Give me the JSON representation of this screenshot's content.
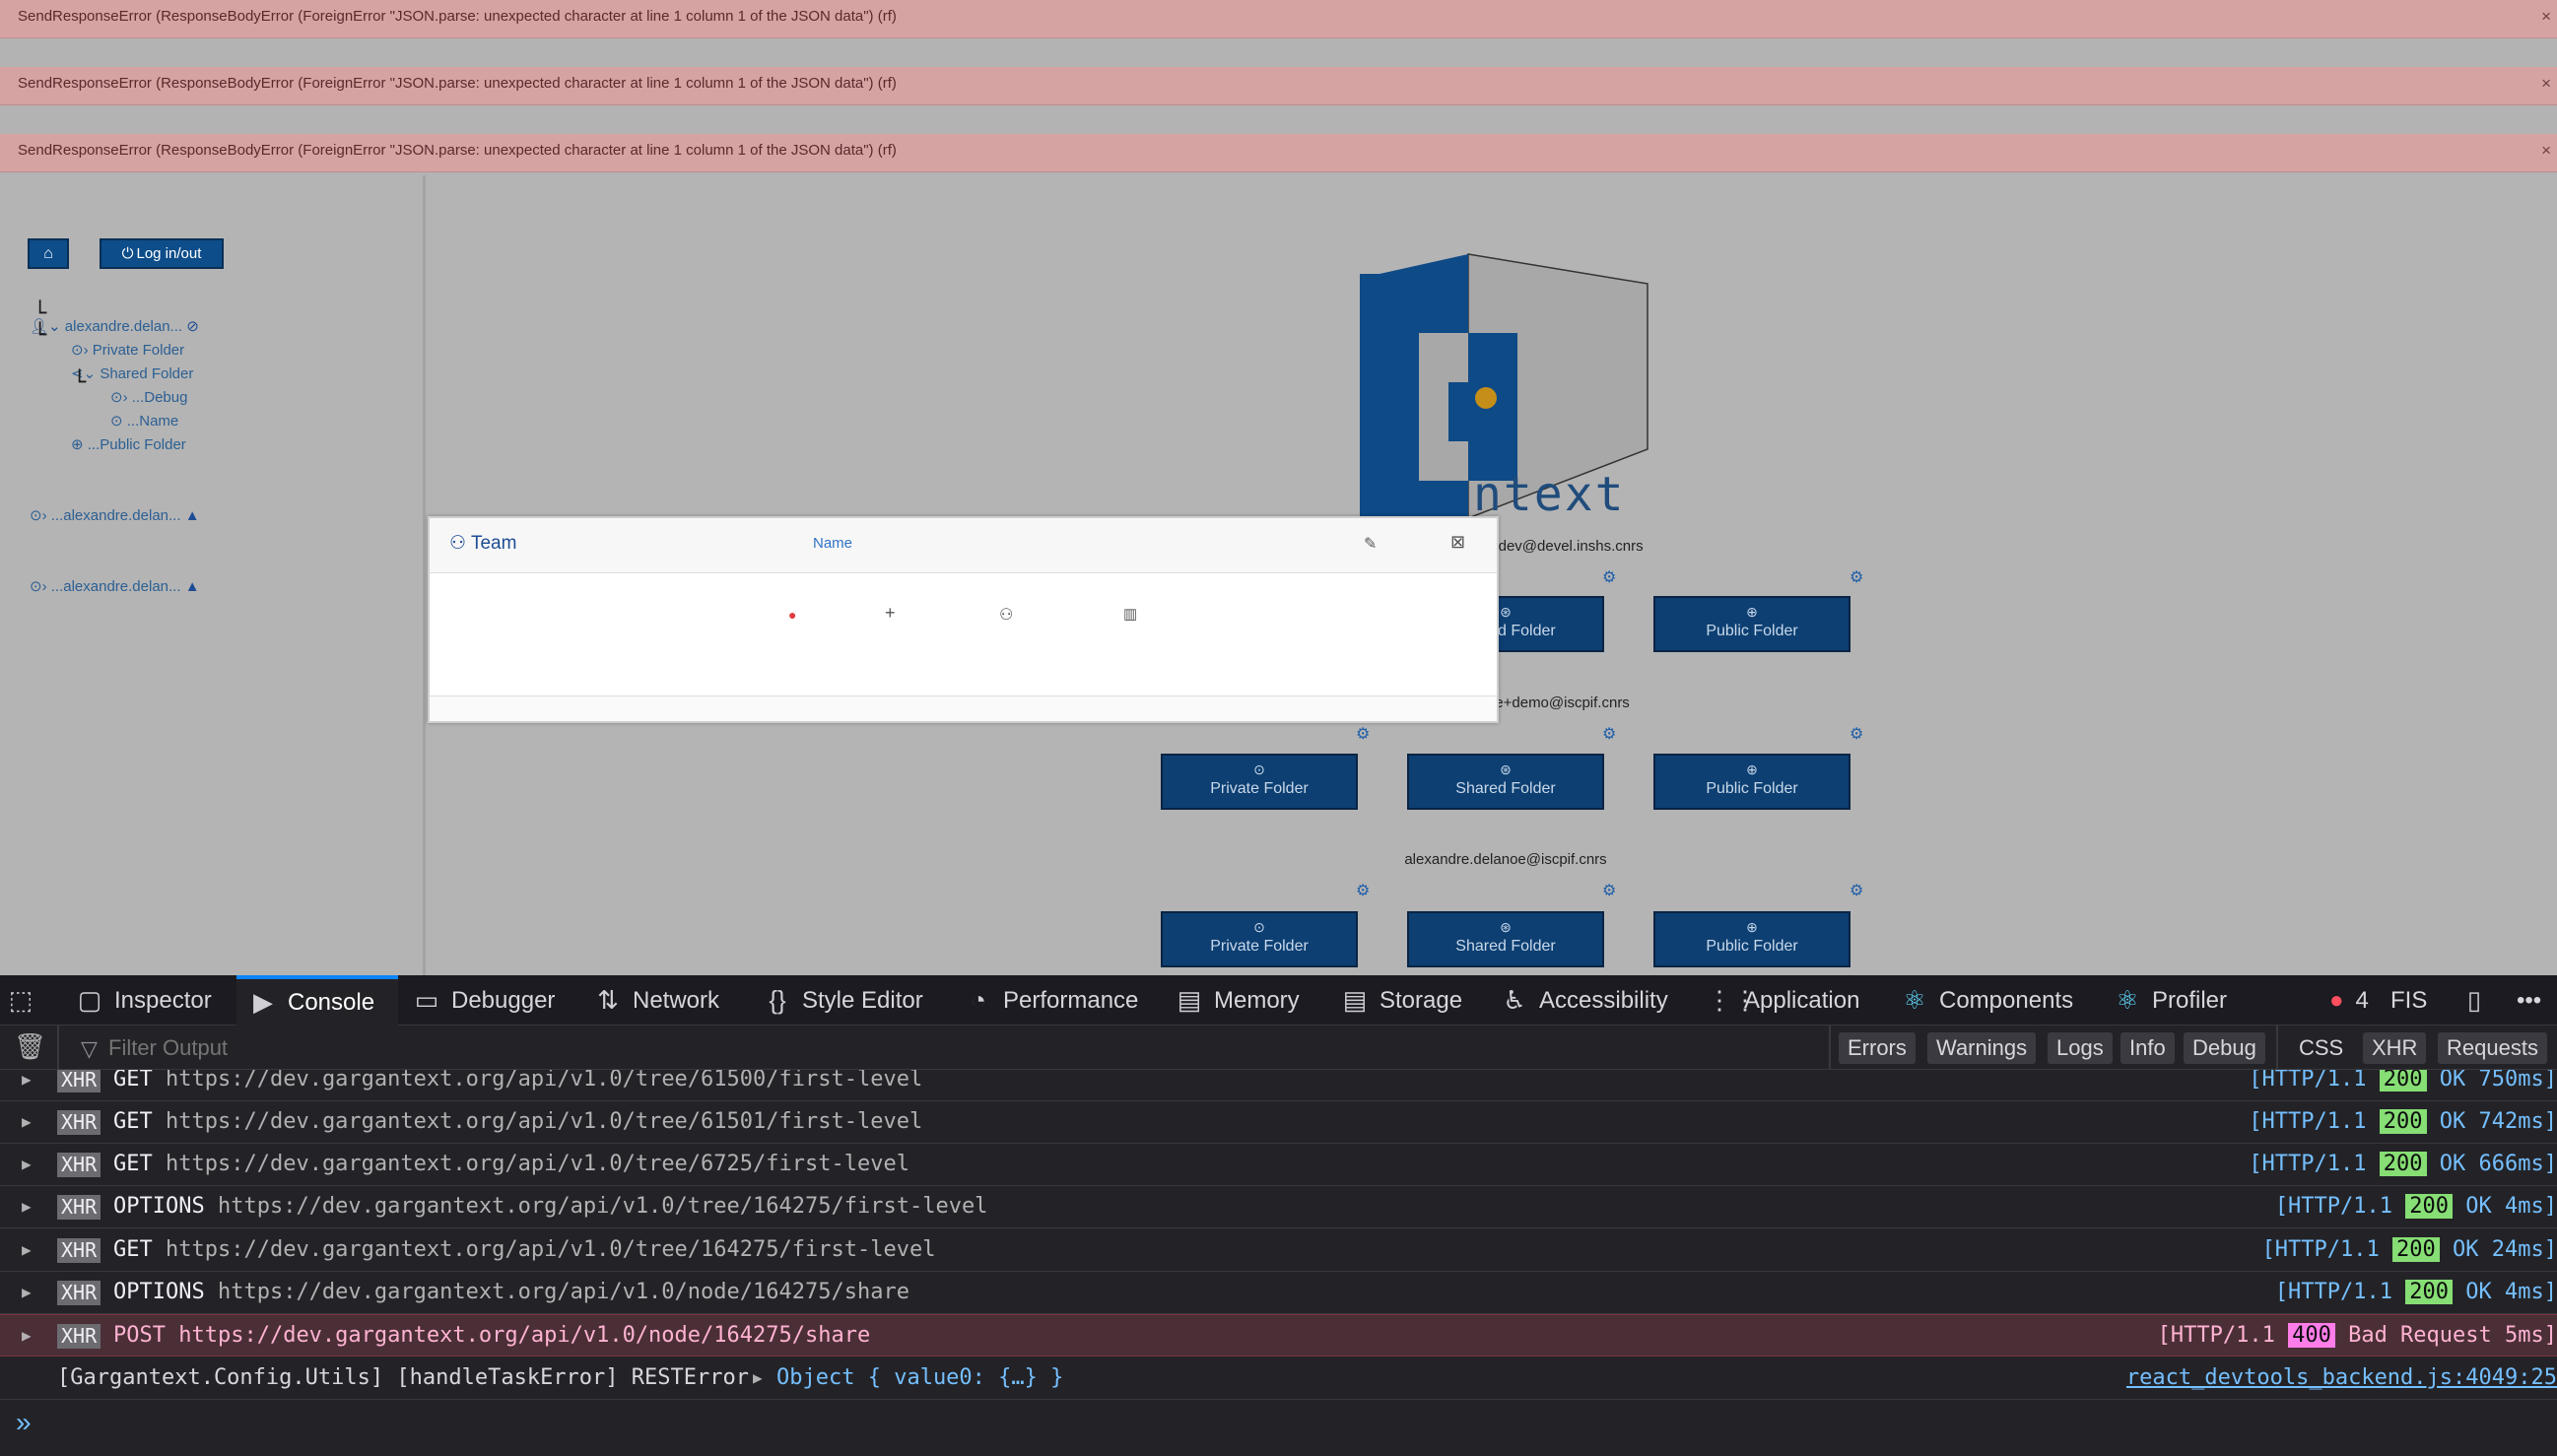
{
  "errors": [
    "SendResponseError (ResponseBodyError (ForeignError \"JSON.parse: unexpected character at line 1 column 1 of the JSON data\") (rf)",
    "SendResponseError (ResponseBodyError (ForeignError \"JSON.parse: unexpected character at line 1 column 1 of the JSON data\") (rf)",
    "SendResponseError (ResponseBodyError (ForeignError \"JSON.parse: unexpected character at line 1 column 1 of the JSON data\") (rf)"
  ],
  "close_symbol": "×",
  "sidebar": {
    "home_icon": "home-icon",
    "login_label": "Log in/out",
    "user_label": "alexandre.delan...",
    "private_folder": "Private Folder",
    "shared_folder": "Shared Folder",
    "debug": "...Debug",
    "name": "...Name",
    "public_folder": "...Public Folder",
    "user2": "...alexandre.delan...",
    "user3": "...alexandre.delan..."
  },
  "logo_text": "ntext",
  "modal": {
    "title": "Team",
    "name_label": "Name"
  },
  "accounts": [
    {
      "email": "alexandre.delanoe+dev@devel.inshs.cnrs"
    },
    {
      "email": "alexandre.delanoe+demo@iscpif.cnrs"
    },
    {
      "email": "alexandre.delanoe@iscpif.cnrs"
    }
  ],
  "folders": {
    "private": "Private Folder",
    "shared": "Shared Folder",
    "public": "Public Folder"
  },
  "devtools": {
    "tabs": [
      "Inspector",
      "Console",
      "Debugger",
      "Network",
      "Style Editor",
      "Performance",
      "Memory",
      "Storage",
      "Accessibility",
      "Application",
      "Components",
      "Profiler"
    ],
    "error_count": "4",
    "locale": "FIS",
    "filter_placeholder": "Filter Output",
    "filters": [
      "Errors",
      "Warnings",
      "Logs",
      "Info",
      "Debug",
      "CSS",
      "XHR",
      "Requests"
    ],
    "logs": [
      {
        "method": "GET",
        "url": "https://dev.gargantext.org/api/v1.0/tree/61500/first-level",
        "proto": "[HTTP/1.1",
        "code": "200",
        "rest": "OK 750ms]"
      },
      {
        "method": "GET",
        "url": "https://dev.gargantext.org/api/v1.0/tree/61501/first-level",
        "proto": "[HTTP/1.1",
        "code": "200",
        "rest": "OK 742ms]"
      },
      {
        "method": "GET",
        "url": "https://dev.gargantext.org/api/v1.0/tree/6725/first-level",
        "proto": "[HTTP/1.1",
        "code": "200",
        "rest": "OK 666ms]"
      },
      {
        "method": "OPTIONS",
        "url": "https://dev.gargantext.org/api/v1.0/tree/164275/first-level",
        "proto": "[HTTP/1.1",
        "code": "200",
        "rest": "OK 4ms]"
      },
      {
        "method": "GET",
        "url": "https://dev.gargantext.org/api/v1.0/tree/164275/first-level",
        "proto": "[HTTP/1.1",
        "code": "200",
        "rest": "OK 24ms]"
      },
      {
        "method": "OPTIONS",
        "url": "https://dev.gargantext.org/api/v1.0/node/164275/share",
        "proto": "[HTTP/1.1",
        "code": "200",
        "rest": "OK 4ms]"
      },
      {
        "method": "POST",
        "url": "https://dev.gargantext.org/api/v1.0/node/164275/share",
        "proto": "[HTTP/1.1",
        "code": "400",
        "rest": "Bad Request 5ms]"
      }
    ],
    "xhr_label": "XHR",
    "task_error": "[Gargantext.Config.Utils] [handleTaskError] RESTError",
    "object_text": "Object { value0: {…} }",
    "source": "react_devtools_backend.js:4049:25",
    "prompt": "»"
  }
}
